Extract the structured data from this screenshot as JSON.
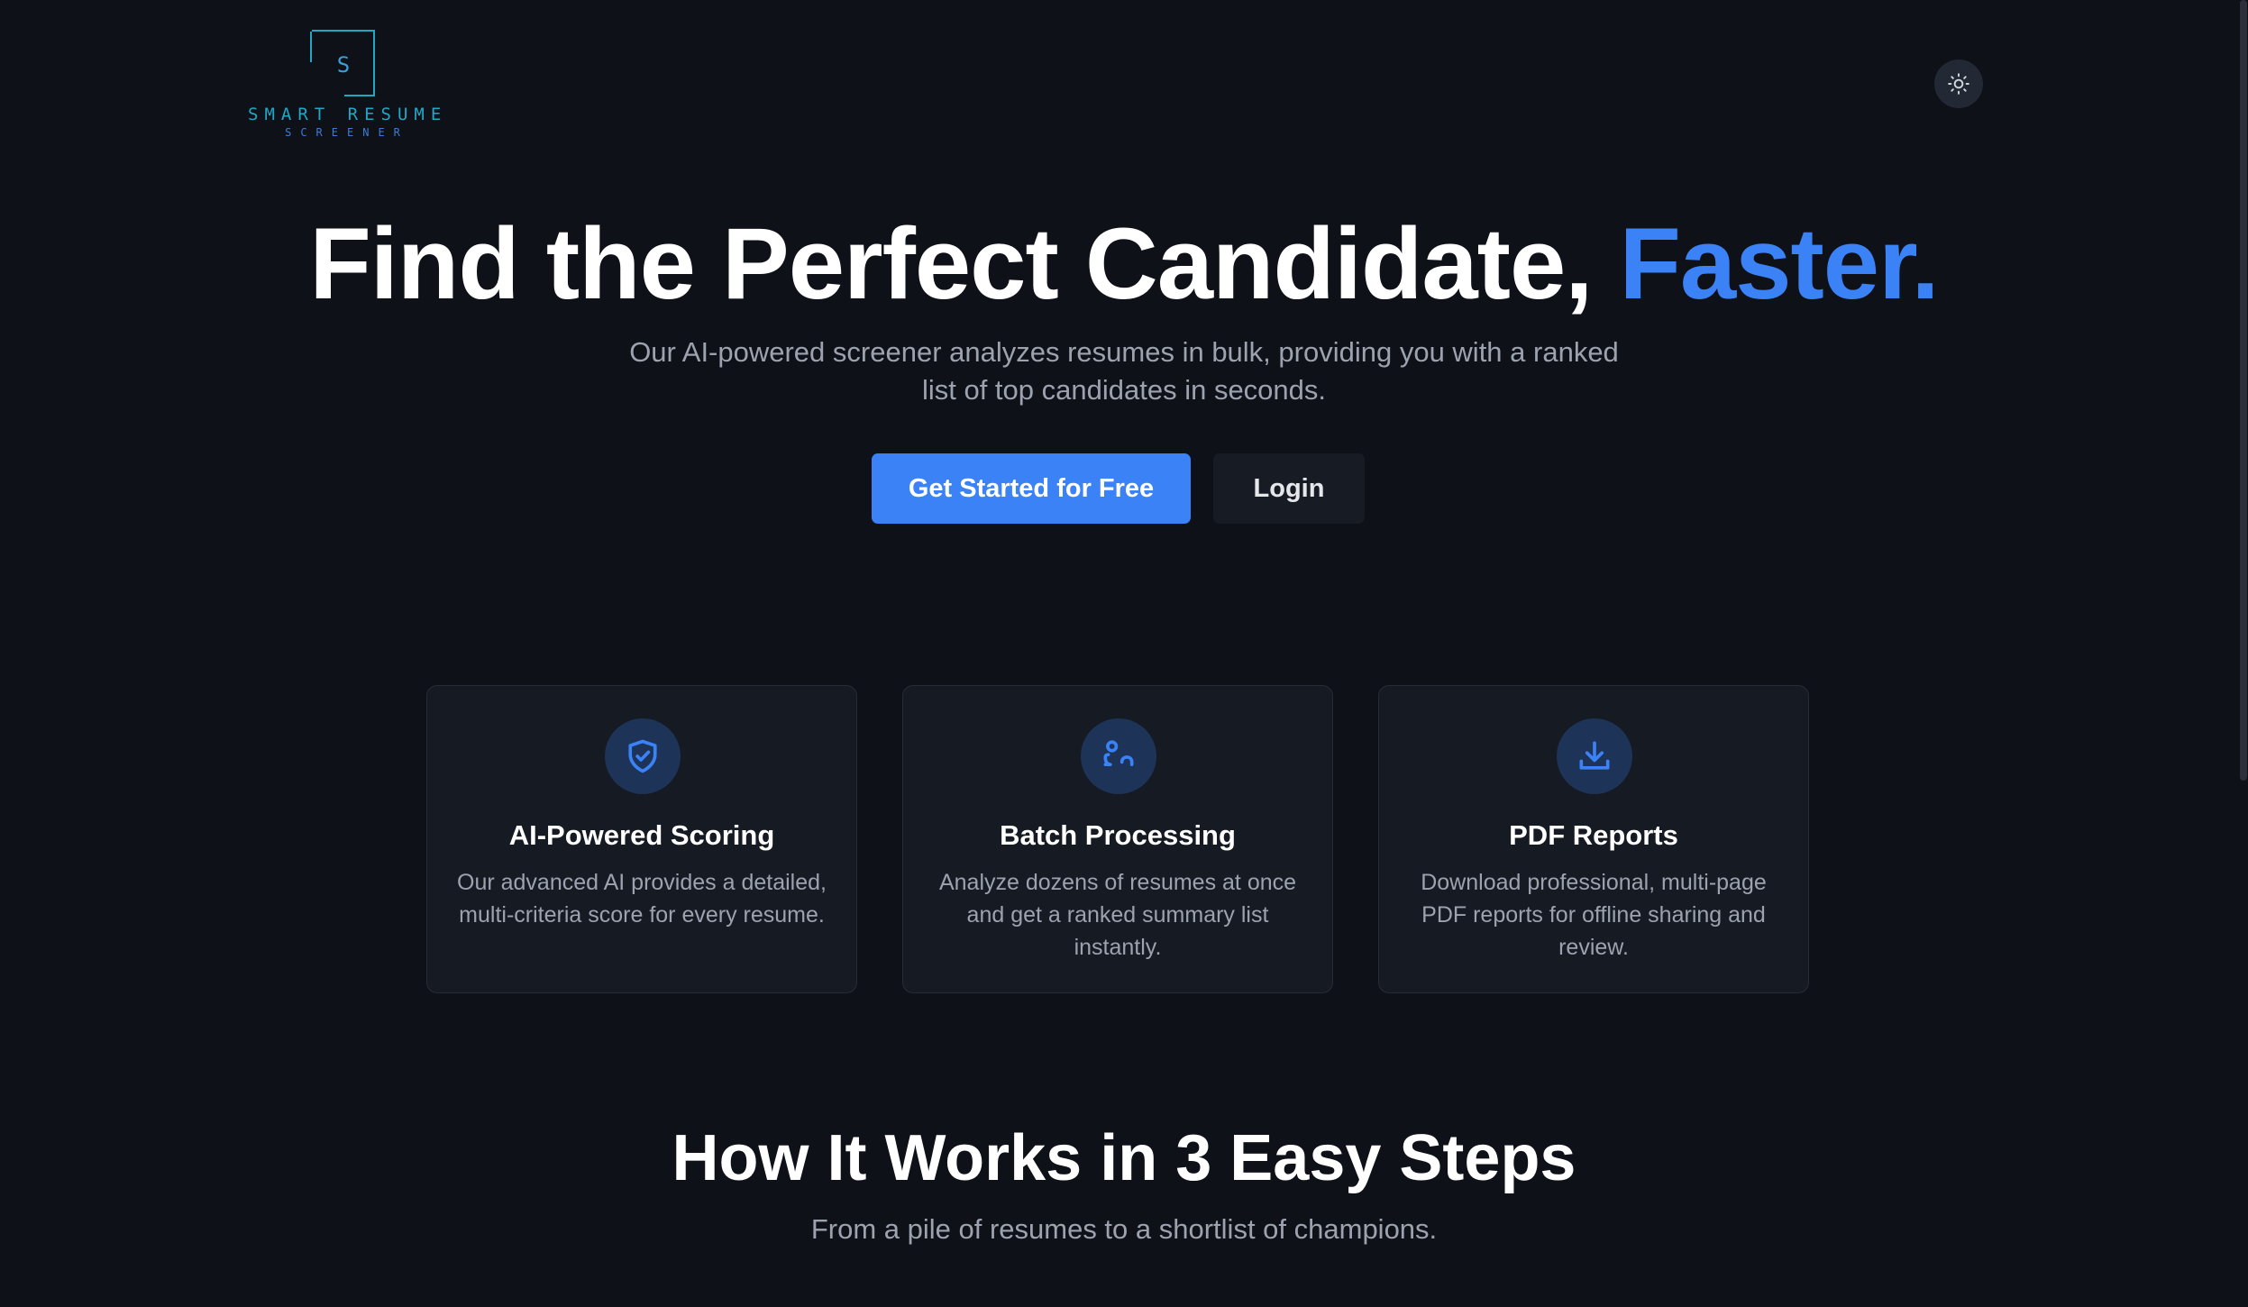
{
  "header": {
    "logo": {
      "letter": "S",
      "name": "SMART RESUME",
      "subtitle": "SCREENER"
    },
    "theme_toggle_icon": "sun-icon"
  },
  "hero": {
    "title_main": "Find the Perfect Candidate, ",
    "title_accent": "Faster.",
    "subtitle": "Our AI-powered screener analyzes resumes in bulk, providing you with a ranked list of top candidates in seconds.",
    "primary_button": "Get Started for Free",
    "secondary_button": "Login"
  },
  "features": [
    {
      "icon": "shield-check-icon",
      "title": "AI-Powered Scoring",
      "description": "Our advanced AI provides a detailed, multi-criteria score for every resume."
    },
    {
      "icon": "users-icon",
      "title": "Batch Processing",
      "description": "Analyze dozens of resumes at once and get a ranked summary list instantly."
    },
    {
      "icon": "download-icon",
      "title": "PDF Reports",
      "description": "Download professional, multi-page PDF reports for offline sharing and review."
    }
  ],
  "how_it_works": {
    "title": "How It Works in 3 Easy Steps",
    "subtitle": "From a pile of resumes to a shortlist of champions."
  },
  "colors": {
    "background": "#0e1118",
    "accent": "#3b82f6",
    "card_background": "#161a22",
    "logo_teal": "#22a6c6"
  }
}
